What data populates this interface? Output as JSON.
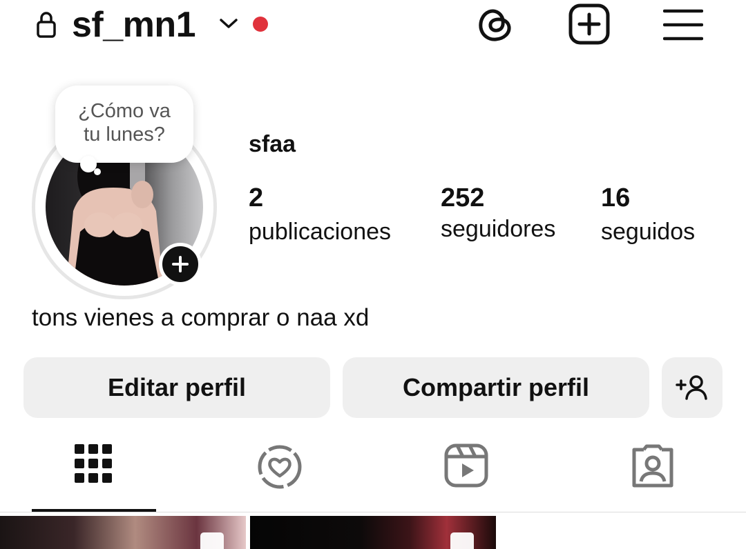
{
  "header": {
    "username": "sf_mn1",
    "notification_color": "#e0323c"
  },
  "note": {
    "line1": "¿Cómo va",
    "line2": "tu lunes?"
  },
  "profile": {
    "display_name": "sfaa",
    "stats": [
      {
        "value": "2",
        "label": "publicaciones"
      },
      {
        "value": "252",
        "label": "seguidores"
      },
      {
        "value": "16",
        "label": "seguidos"
      }
    ],
    "bio": "tons vienes a comprar o naa xd"
  },
  "actions": {
    "edit_label": "Editar perfil",
    "share_label": "Compartir perfil"
  },
  "tabs": {
    "icons": [
      "grid-icon",
      "heart-circle-icon",
      "reels-icon",
      "tagged-person-icon"
    ],
    "active": "grid-icon"
  }
}
